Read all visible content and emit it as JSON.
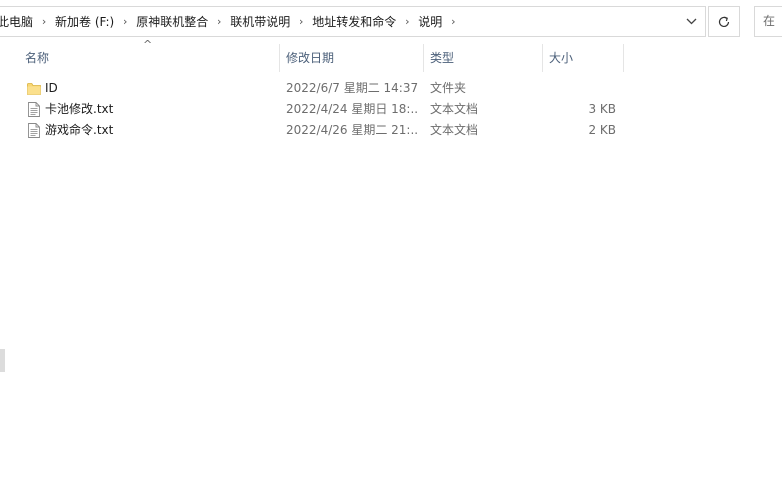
{
  "address_bar": {
    "breadcrumbs": [
      "此电脑",
      "新加卷 (F:)",
      "原神联机整合",
      "联机带说明",
      "地址转发和命令",
      "说明"
    ]
  },
  "search": {
    "placeholder": "在 说明 中搜索",
    "visible_text": "在"
  },
  "columns": {
    "name": "名称",
    "modified": "修改日期",
    "type": "类型",
    "size": "大小"
  },
  "files": [
    {
      "name": "ID",
      "modified": "2022/6/7 星期二 14:37",
      "type": "文件夹",
      "size": "",
      "icon": "folder-icon"
    },
    {
      "name": "卡池修改.txt",
      "modified": "2022/4/24 星期日 18:...",
      "type": "文本文档",
      "size": "3 KB",
      "icon": "text-file-icon"
    },
    {
      "name": "游戏命令.txt",
      "modified": "2022/4/26 星期二 21:...",
      "type": "文本文档",
      "size": "2 KB",
      "icon": "text-file-icon"
    }
  ],
  "colors": {
    "header_text": "#4c607a",
    "folder": "#f8d775",
    "border": "#d9d9d9"
  }
}
